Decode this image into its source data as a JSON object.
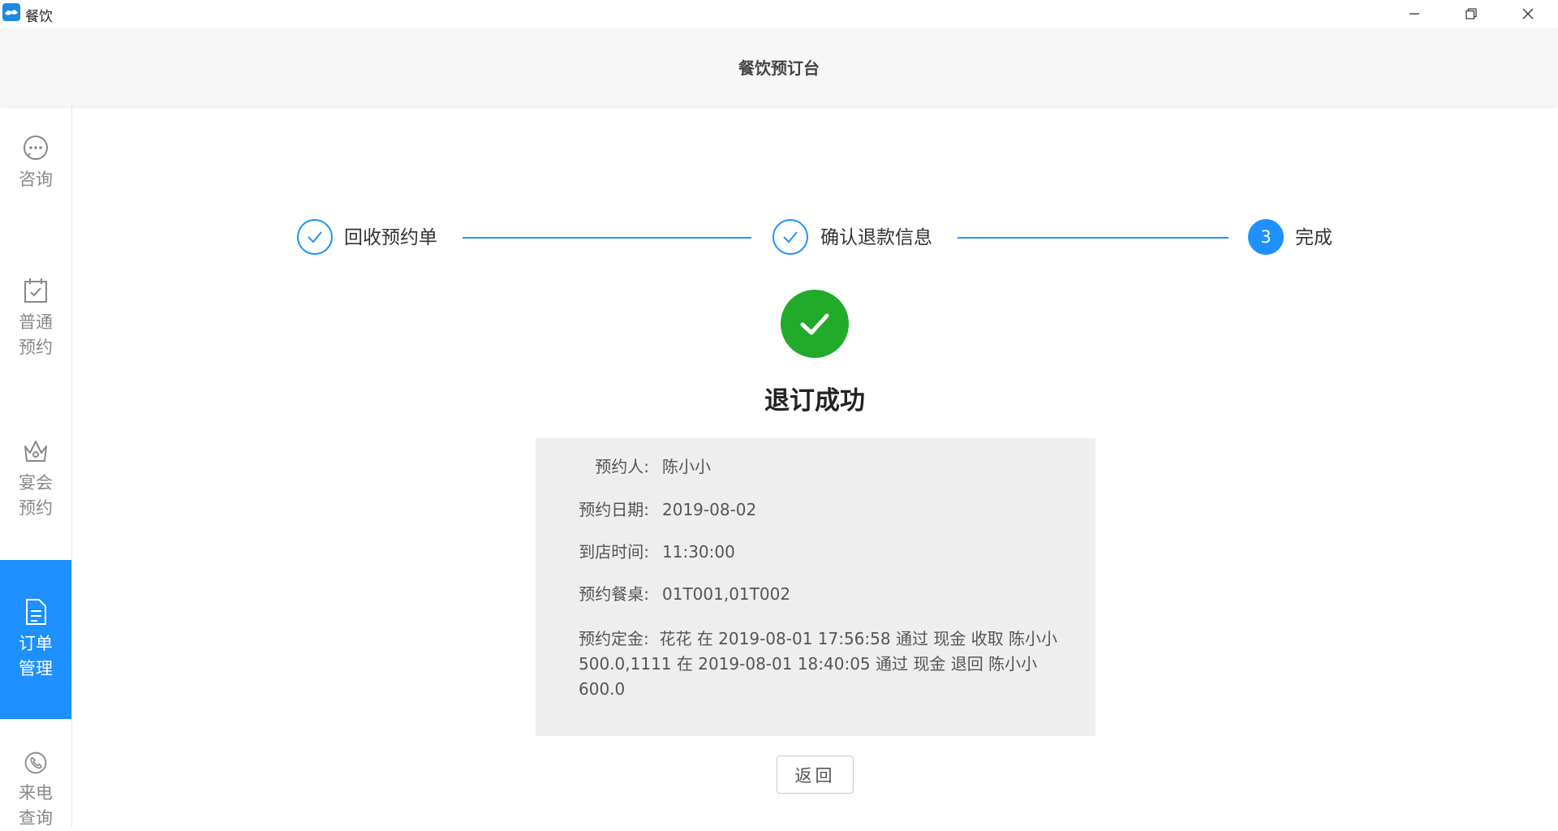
{
  "window": {
    "title": "餐饮"
  },
  "header": {
    "title": "餐饮预订台"
  },
  "sidebar": {
    "items": [
      {
        "label_lines": [
          "咨询"
        ],
        "icon": "chat-icon"
      },
      {
        "label_lines": [
          "普通",
          "预约"
        ],
        "icon": "calendar-check-icon"
      },
      {
        "label_lines": [
          "宴会",
          "预约"
        ],
        "icon": "crown-icon"
      },
      {
        "label_lines": [
          "订单",
          "管理"
        ],
        "icon": "document-icon",
        "active": true
      },
      {
        "label_lines": [
          "来电",
          "查询"
        ],
        "icon": "phone-icon"
      }
    ]
  },
  "steps": [
    {
      "label": "回收预约单",
      "status": "done"
    },
    {
      "label": "确认退款信息",
      "status": "done"
    },
    {
      "number": "3",
      "label": "完成",
      "status": "current"
    }
  ],
  "result": {
    "title": "退订成功",
    "fields": [
      {
        "label": "预约人:",
        "value": "陈小小"
      },
      {
        "label": "预约日期:",
        "value": "2019-08-02"
      },
      {
        "label": "到店时间:",
        "value": "11:30:00"
      },
      {
        "label": "预约餐桌:",
        "value": "01T001,01T002"
      }
    ],
    "deposit": {
      "label": "预约定金:",
      "lines": [
        "花花 在 2019-08-01 17:56:58 通过 现金 收取 陈小小",
        "500.0,1111 在 2019-08-01 18:40:05 通过 现金 退回 陈小小",
        "600.0"
      ]
    }
  },
  "actions": {
    "back_label": "返回"
  },
  "colors": {
    "accent": "#1e90ff",
    "success": "#22aa2a",
    "panel": "#eeeeee"
  }
}
